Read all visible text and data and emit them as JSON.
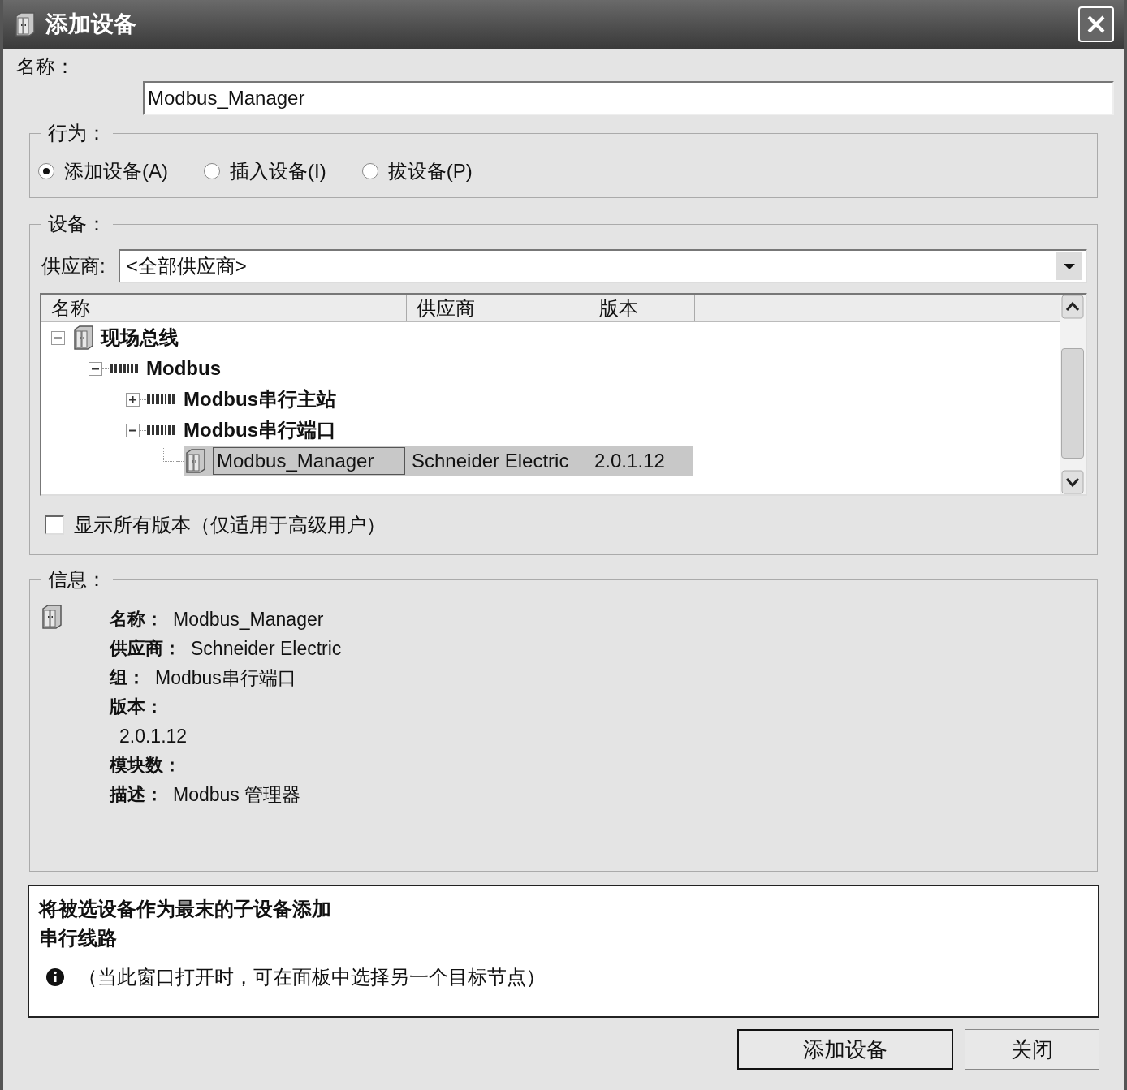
{
  "window": {
    "title": "添加设备"
  },
  "name": {
    "label": "名称：",
    "value": "Modbus_Manager"
  },
  "action": {
    "label": "行为：",
    "options": [
      {
        "label": "添加设备(A)",
        "selected": true
      },
      {
        "label": "插入设备(I)",
        "selected": false
      },
      {
        "label": "拔设备(P)",
        "selected": false
      }
    ]
  },
  "device": {
    "label": "设备：",
    "vendor_label": "供应商:",
    "vendor_value": "<全部供应商>",
    "columns": [
      "名称",
      "供应商",
      "版本"
    ],
    "tree": [
      {
        "name": "现场总线",
        "kind": "cabinet",
        "expanded": true,
        "selected": false,
        "children": [
          {
            "name": "Modbus",
            "kind": "bus",
            "expanded": true,
            "selected": false,
            "children": [
              {
                "name": "Modbus串行主站",
                "kind": "bus",
                "expanded": false,
                "selected": false
              },
              {
                "name": "Modbus串行端口",
                "kind": "bus",
                "expanded": true,
                "selected": false,
                "children": [
                  {
                    "name": "Modbus_Manager",
                    "kind": "cabinet",
                    "vendor": "Schneider Electric",
                    "version": "2.0.1.12",
                    "selected": true
                  }
                ]
              }
            ]
          }
        ]
      }
    ],
    "show_all": {
      "label": "显示所有版本（仅适用于高级用户）",
      "checked": false
    }
  },
  "info": {
    "label": "信息：",
    "fields": [
      {
        "label": "名称：",
        "value": "Modbus_Manager",
        "kind": "inline"
      },
      {
        "label": "供应商：",
        "value": "Schneider Electric",
        "kind": "inline"
      },
      {
        "label": "组：",
        "value": "Modbus串行端口",
        "kind": "inline"
      },
      {
        "label": "版本：",
        "value": "2.0.1.12",
        "kind": "below"
      },
      {
        "label": "模块数：",
        "kind": "inline"
      },
      {
        "label": "描述：",
        "value": "Modbus 管理器",
        "kind": "inline"
      }
    ]
  },
  "message": {
    "lines": [
      "将被选设备作为最末的子设备添加",
      "串行线路"
    ],
    "note": "（当此窗口打开时，可在面板中选择另一个目标节点）"
  },
  "buttons": [
    {
      "label": "添加设备",
      "default": true
    },
    {
      "label": "关闭",
      "default": false
    }
  ]
}
